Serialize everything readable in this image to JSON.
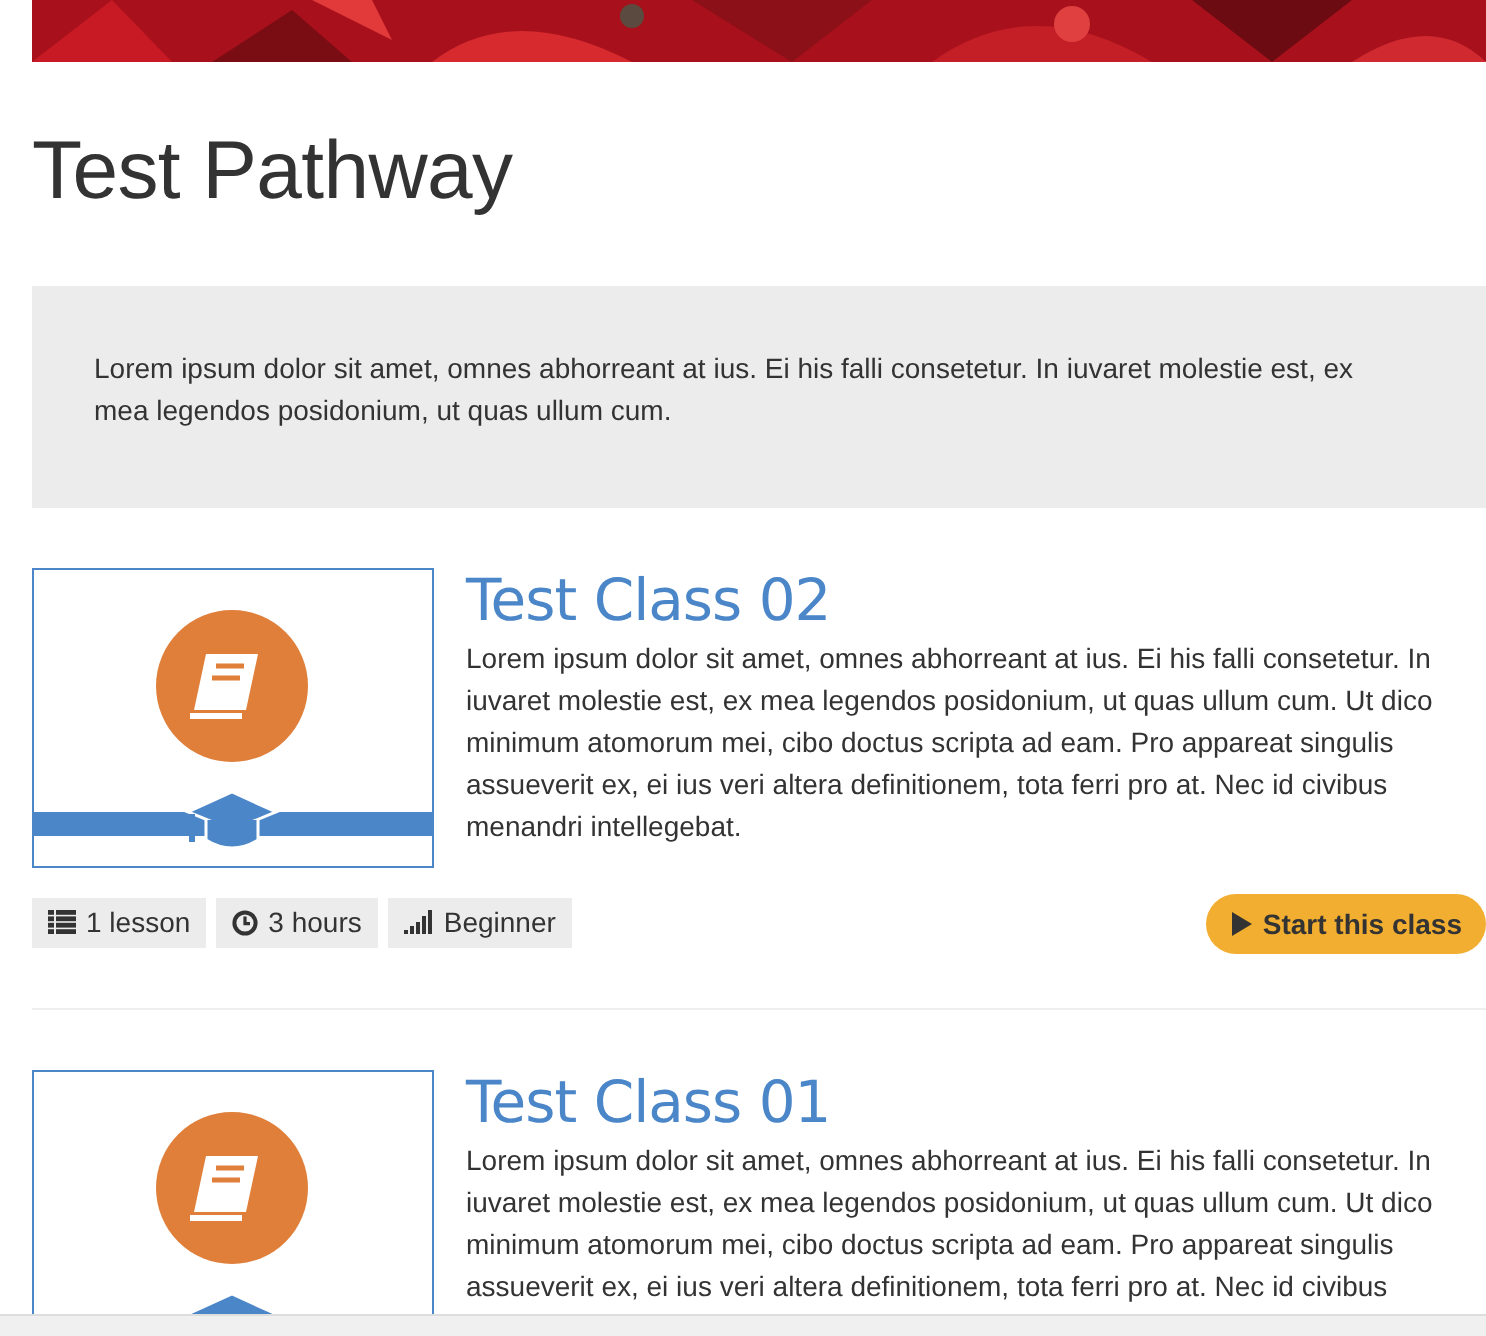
{
  "title": "Test Pathway",
  "intro": "Lorem ipsum dolor sit amet, omnes abhorreant at ius. Ei his falli consetetur. In iuvaret molestie est, ex mea legendos posidonium, ut quas ullum cum.",
  "classes": [
    {
      "title": "Test Class 02",
      "description": "Lorem ipsum dolor sit amet, omnes abhorreant at ius. Ei his falli consetetur. In iuvaret molestie est, ex mea legendos posidonium, ut quas ullum cum. Ut dico minimum atomorum mei, cibo doctus scripta ad eam. Pro appareat singulis assueverit ex, ei ius veri altera definitionem, tota ferri pro at. Nec id civibus menandri intellegebat.",
      "meta": [
        {
          "kind": "lessons",
          "text": "1 lesson"
        },
        {
          "kind": "duration",
          "text": "3 hours"
        },
        {
          "kind": "level",
          "text": "Beginner"
        }
      ],
      "button": "Start this class"
    },
    {
      "title": "Test Class 01",
      "description": "Lorem ipsum dolor sit amet, omnes abhorreant at ius. Ei his falli consetetur. In iuvaret molestie est, ex mea legendos posidonium, ut quas ullum cum. Ut dico minimum atomorum mei, cibo doctus scripta ad eam. Pro appareat singulis assueverit ex, ei ius veri altera definitionem, tota ferri pro at. Nec id civibus"
    }
  ]
}
